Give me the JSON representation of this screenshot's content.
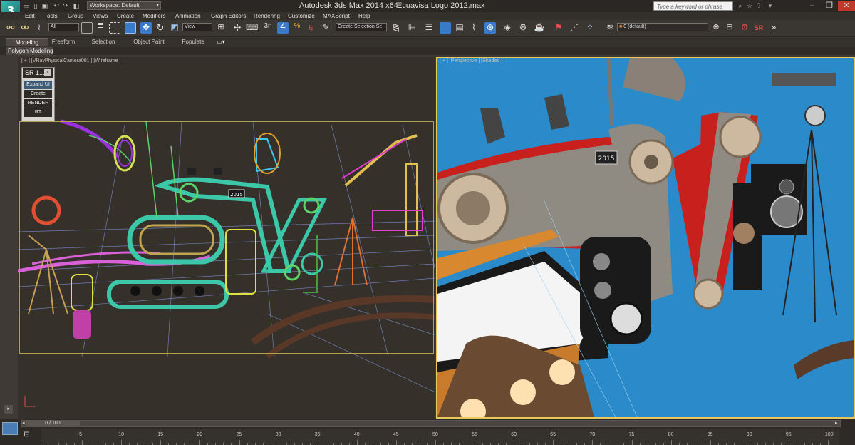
{
  "titlebar": {
    "app_title": "Autodesk 3ds Max  2014 x64",
    "file_name": "Ecuavisa Logo 2012.max",
    "workspace_label": "Workspace: Default",
    "search_placeholder": "Type a keyword or phrase",
    "logo": "3"
  },
  "menu": [
    "Edit",
    "Tools",
    "Group",
    "Views",
    "Create",
    "Modifiers",
    "Animation",
    "Graph Editors",
    "Rendering",
    "Customize",
    "MAXScript",
    "Help"
  ],
  "toolbar": {
    "selection_filter": "All",
    "ref_coord": "View",
    "named_selection": "Create Selection Se",
    "layer": "0 (default)",
    "sr_label": "SR"
  },
  "ribbon": {
    "tabs": [
      "Modeling",
      "Freeform",
      "Selection",
      "Object Paint",
      "Populate"
    ],
    "subtab": "Polygon Modeling"
  },
  "viewports": {
    "left_label": "[ + ] [VRayPhysicalCamera001 ] [Wireframe ]",
    "right_label": "[ + ] [Perspective ] [Shaded ]",
    "counter_left": "2015",
    "counter_right": "2015"
  },
  "sr_panel": {
    "title": "SR 1...",
    "close": "x",
    "buttons": [
      "Expand UI",
      "Create",
      "RENDER",
      "RT"
    ]
  },
  "timeline": {
    "frame_display": "0 / 100",
    "ticks": [
      "5",
      "10",
      "15",
      "20",
      "25",
      "30",
      "35",
      "40",
      "45",
      "50",
      "55",
      "60",
      "65",
      "70",
      "75",
      "80",
      "85",
      "90",
      "95",
      "100"
    ]
  },
  "colors": {
    "viewport_left_bg": "#36302a",
    "viewport_right_bg": "#2b89c8",
    "active_border": "#e8c85a",
    "wood": "#8f8a82",
    "red": "#c8201c"
  }
}
